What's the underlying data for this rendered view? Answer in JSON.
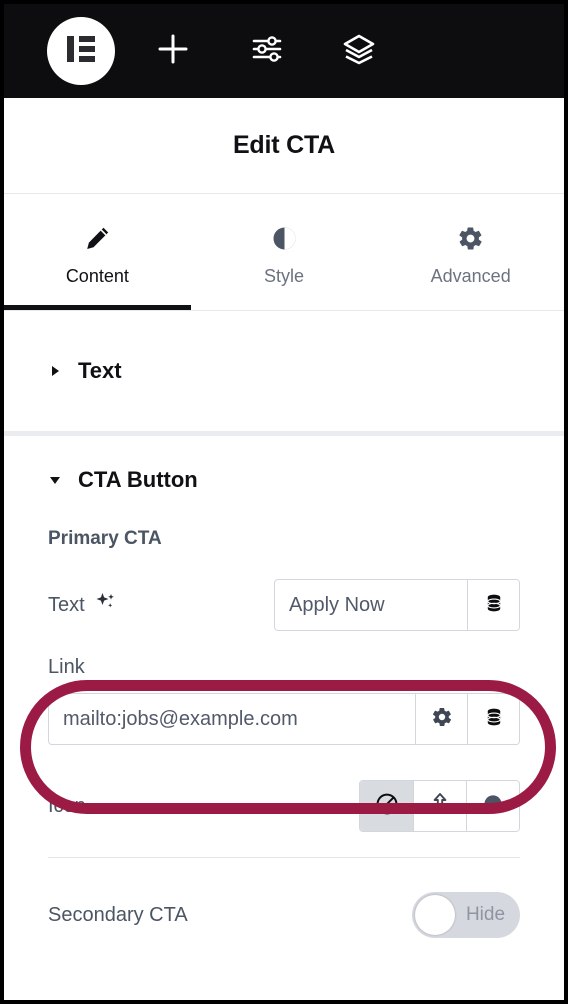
{
  "toolbar": {
    "logo": "elementor-logo",
    "buttons": [
      {
        "name": "add-element-button",
        "icon": "plus-icon"
      },
      {
        "name": "site-settings-button",
        "icon": "sliders-icon"
      },
      {
        "name": "navigator-button",
        "icon": "layers-icon"
      }
    ]
  },
  "header": {
    "title": "Edit CTA"
  },
  "tabs": [
    {
      "label": "Content",
      "icon": "pencil-icon",
      "active": true
    },
    {
      "label": "Style",
      "icon": "contrast-circle-icon",
      "active": false
    },
    {
      "label": "Advanced",
      "icon": "gear-icon",
      "active": false
    }
  ],
  "sections": [
    {
      "label": "Text",
      "expanded": false,
      "caret": "caret-right-icon"
    },
    {
      "label": "CTA Button",
      "expanded": true,
      "caret": "caret-down-icon"
    }
  ],
  "cta_button": {
    "group_label": "Primary CTA",
    "text_row": {
      "label": "Text",
      "ai_icon": "sparkle-ai-icon",
      "value": "Apply Now",
      "dynamic_tag_icon": "database-icon"
    },
    "link_row": {
      "label": "Link",
      "value": "mailto:jobs@example.com",
      "options_icon": "gear-icon",
      "dynamic_tag_icon": "database-icon",
      "highlighted": true,
      "highlight_color": "#9c1b45"
    },
    "icon_row": {
      "label": "Icon",
      "options": [
        {
          "name": "icon-none",
          "icon": "ban-icon",
          "selected": true
        },
        {
          "name": "icon-upload-svg",
          "icon": "upload-icon",
          "selected": false
        },
        {
          "name": "icon-library",
          "icon": "filled-circle-icon",
          "selected": false
        }
      ]
    },
    "secondary_row": {
      "label": "Secondary CTA",
      "toggle_label": "Hide",
      "toggle_on": false
    }
  },
  "colors": {
    "toolbar_bg": "#0d0d0f",
    "accent_highlight": "#9c1b45",
    "active_tab": "#101114",
    "muted_text": "#6b7280"
  }
}
